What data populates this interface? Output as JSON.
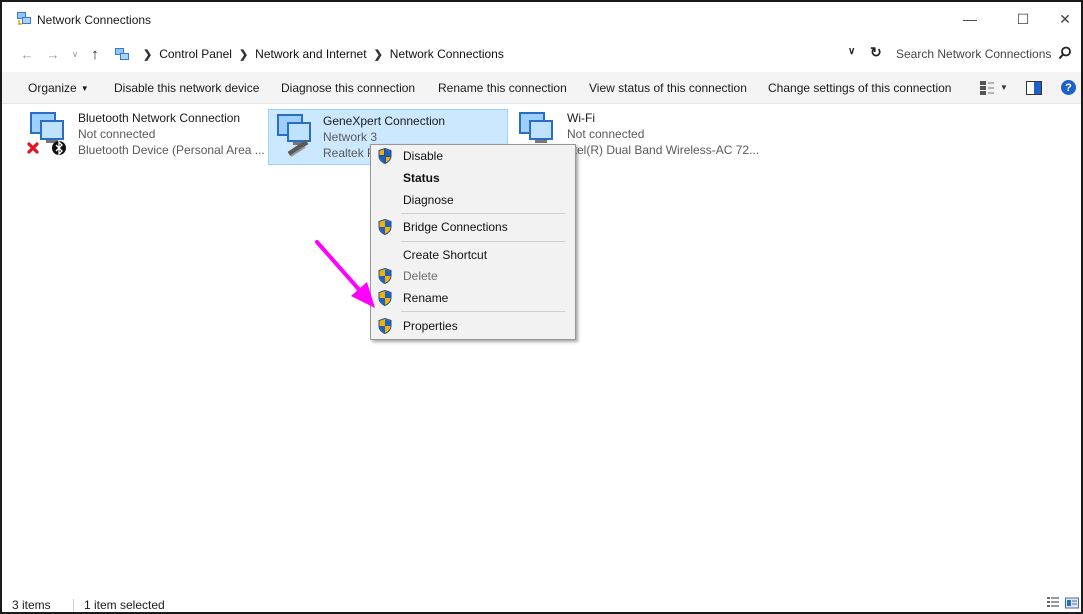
{
  "window": {
    "title": "Network Connections"
  },
  "breadcrumbs": [
    "Control Panel",
    "Network and Internet",
    "Network Connections"
  ],
  "search": {
    "placeholder": "Search Network Connections"
  },
  "commands": {
    "organize": "Organize",
    "disable": "Disable this network device",
    "diagnose": "Diagnose this connection",
    "rename": "Rename this connection",
    "status": "View status of this connection",
    "change": "Change settings of this connection"
  },
  "items": [
    {
      "name": "Bluetooth Network Connection",
      "status": "Not connected",
      "device": "Bluetooth Device (Personal Area ..."
    },
    {
      "name": "GeneXpert Connection",
      "status": "Network  3",
      "device": "Realtek PC"
    },
    {
      "name": "Wi-Fi",
      "status": "Not connected",
      "device": "ntel(R) Dual Band Wireless-AC 72..."
    }
  ],
  "context_menu": [
    {
      "label": "Disable",
      "shield": true,
      "bold": false,
      "disabled": false
    },
    {
      "label": "Status",
      "shield": false,
      "bold": true,
      "disabled": false
    },
    {
      "label": "Diagnose",
      "shield": false,
      "bold": false,
      "disabled": false
    },
    {
      "label": "Bridge Connections",
      "shield": true,
      "bold": false,
      "disabled": false
    },
    {
      "label": "Create Shortcut",
      "shield": false,
      "bold": false,
      "disabled": false
    },
    {
      "label": "Delete",
      "shield": true,
      "bold": false,
      "disabled": true
    },
    {
      "label": "Rename",
      "shield": true,
      "bold": false,
      "disabled": false
    },
    {
      "label": "Properties",
      "shield": true,
      "bold": false,
      "disabled": false
    }
  ],
  "status_bar": {
    "item_count": "3 items",
    "selection": "1 item selected"
  },
  "colors": {
    "selection": "#cce8ff",
    "annotation_arrow": "#ff00ff",
    "help": "#1e62c9"
  },
  "icons": [
    "network-connections-icon",
    "search-icon",
    "shield-icon",
    "bluetooth-icon",
    "disconnected-x-icon",
    "ethernet-adapter-icon",
    "wifi-adapter-icon",
    "help-icon"
  ]
}
